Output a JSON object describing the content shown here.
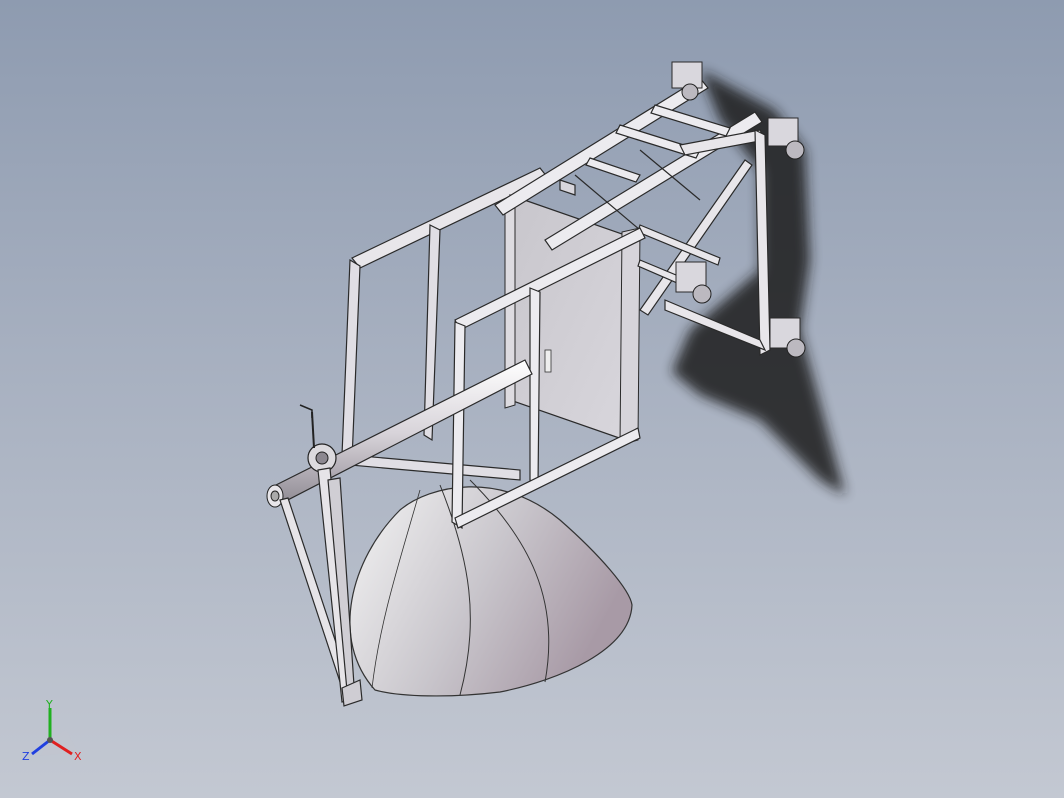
{
  "triad": {
    "x_label": "X",
    "y_label": "Y",
    "z_label": "Z",
    "colors": {
      "x": "#e02020",
      "y": "#20b020",
      "z": "#2040e0"
    }
  }
}
